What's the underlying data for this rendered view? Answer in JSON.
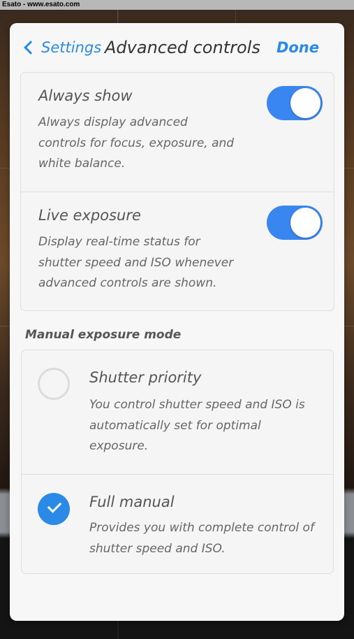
{
  "watermark": "Esato - www.esato.com",
  "nav": {
    "back_label": "Settings",
    "title": "Advanced controls",
    "done_label": "Done"
  },
  "settings": [
    {
      "title": "Always show",
      "description_lines": [
        "Always display advanced",
        "controls for focus, exposure, and",
        "white balance."
      ],
      "enabled": true
    },
    {
      "title": "Live exposure",
      "description_lines": [
        "Display real-time status for",
        "shutter speed and ISO whenever",
        "advanced controls are shown."
      ],
      "enabled": true
    }
  ],
  "manual_exposure": {
    "header": "Manual exposure mode",
    "options": [
      {
        "title": "Shutter priority",
        "description_lines": [
          "You control shutter speed and ISO is",
          "automatically set for optimal",
          "exposure."
        ],
        "selected": false
      },
      {
        "title": "Full manual",
        "description_lines": [
          "Provides you with complete control of",
          "shutter speed and ISO."
        ],
        "selected": true
      }
    ]
  },
  "colors": {
    "accent": "#2a8ae6",
    "toggle_on": "#3a86f0"
  }
}
